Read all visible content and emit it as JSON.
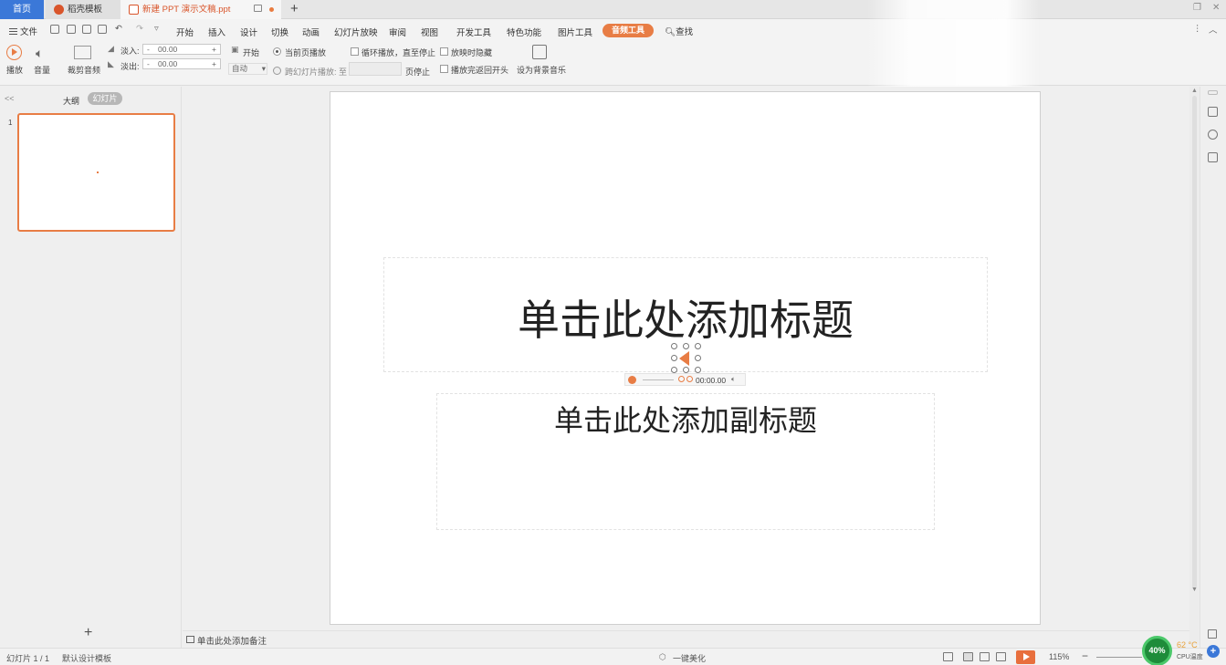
{
  "tabs": {
    "home": "首页",
    "template": "稻壳模板",
    "document": "新建 PPT 演示文稿.ppt",
    "new_tab": "+"
  },
  "menu": {
    "file": "文件",
    "items": [
      "开始",
      "插入",
      "设计",
      "切换",
      "动画",
      "幻灯片放映",
      "审阅",
      "视图",
      "开发工具",
      "特色功能",
      "图片工具"
    ],
    "active": "音频工具",
    "search": "查找"
  },
  "ribbon": {
    "play": "播放",
    "volume": "音量",
    "trim": "裁剪音频",
    "fade_in_label": "淡入:",
    "fade_in_value": "00.00",
    "fade_out_label": "淡出:",
    "fade_out_value": "00.00",
    "start_label": "开始",
    "start_value": "自动",
    "radio_current": "当前页播放",
    "radio_cross": "跨幻灯片播放: 至",
    "page_stop": "页停止",
    "loop": "循环播放，直至停止",
    "hide": "放映时隐藏",
    "rewind": "播放完返回开头",
    "set_bg": "设为背景音乐"
  },
  "left_panel": {
    "collapse": "<<",
    "tab_outline": "大纲",
    "tab_slides": "幻灯片",
    "slide_number": "1",
    "add": "+"
  },
  "slide": {
    "title": "单击此处添加标题",
    "subtitle": "单击此处添加副标题",
    "audio_time": "00:00.00"
  },
  "notes": {
    "placeholder": "单击此处添加备注"
  },
  "status": {
    "slide_count": "幻灯片 1 / 1",
    "template": "默认设计模板",
    "beautify": "一键美化",
    "zoom": "115%",
    "cpu_percent": "40%",
    "cpu_temp": "62 °C",
    "cpu_label": "CPU温度"
  },
  "colors": {
    "accent": "#e87d45",
    "home_tab": "#3b78d8",
    "cpu_green": "#1e8c3a"
  }
}
